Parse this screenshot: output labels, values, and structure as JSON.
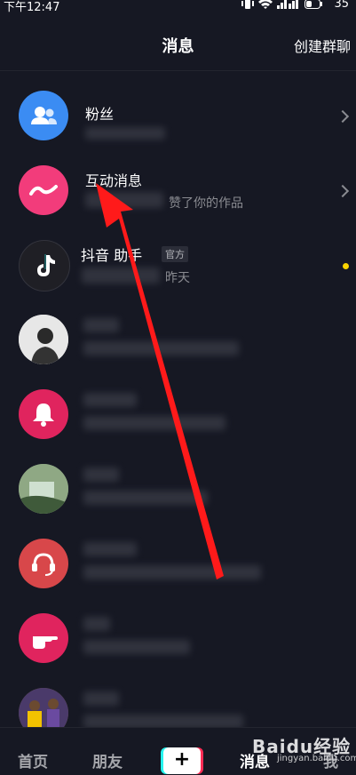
{
  "status_bar": {
    "time": "下午12:47",
    "battery": "35"
  },
  "header": {
    "title": "消息",
    "action": "创建群聊"
  },
  "rows": [
    {
      "name": "粉丝",
      "sub": "",
      "avatar": "fans-icon",
      "color": "#3b8cf3"
    },
    {
      "name": "互动消息",
      "sub": "赞了你的作品",
      "avatar": "interaction-icon",
      "color": "#f23c7b"
    },
    {
      "name": "抖音",
      "name_suffix": "助手",
      "tag": "官方",
      "sub": "昨天",
      "avatar": "douyin-icon",
      "color": "#1f1f25"
    },
    {
      "name": "",
      "sub": "",
      "avatar": "user-avatar-photo",
      "color": "#cfcfcf"
    },
    {
      "name": "",
      "sub": "",
      "avatar": "bell-icon",
      "color": "#e0245e"
    },
    {
      "name": "",
      "sub": "",
      "avatar": "user-avatar-photo",
      "color": "#6a8a66"
    },
    {
      "name": "",
      "sub": "",
      "avatar": "headset-icon",
      "color": "#d8474a"
    },
    {
      "name": "",
      "sub": "",
      "avatar": "pointing-hand-icon",
      "color": "#e0245e"
    },
    {
      "name": "",
      "sub": "",
      "avatar": "user-avatar-photo",
      "color": "#7a5a2a"
    }
  ],
  "nav": {
    "home": "首页",
    "friends": "朋友",
    "plus": "+",
    "messages": "消息",
    "me": "我"
  },
  "watermark": {
    "brand": "Baidu经验",
    "url": "jingyan.baidu.com"
  },
  "colors": {
    "background": "#161823",
    "annotation_arrow": "#ff1a1a",
    "unread_dot": "#fbd400"
  }
}
